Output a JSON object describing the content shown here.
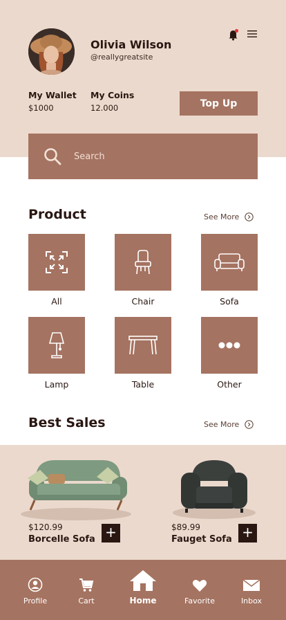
{
  "profile": {
    "name": "Olivia Wilson",
    "handle": "@reallygreatsite"
  },
  "wallet": {
    "wallet_label": "My Wallet",
    "wallet_value": "$1000",
    "coins_label": "My Coins",
    "coins_value": "12.000",
    "topup_label": "Top Up"
  },
  "search": {
    "placeholder": "Search"
  },
  "product_section": {
    "title": "Product",
    "see_more": "See More",
    "categories": [
      {
        "label": "All",
        "icon": "expand-icon"
      },
      {
        "label": "Chair",
        "icon": "chair-icon"
      },
      {
        "label": "Sofa",
        "icon": "sofa-icon"
      },
      {
        "label": "Lamp",
        "icon": "lamp-icon"
      },
      {
        "label": "Table",
        "icon": "table-icon"
      },
      {
        "label": "Other",
        "icon": "more-dots-icon"
      }
    ]
  },
  "best_sales": {
    "title": "Best Sales",
    "see_more": "See More",
    "products": [
      {
        "price": "$120.99",
        "name": "Borcelle Sofa"
      },
      {
        "price": "$89.99",
        "name": "Fauget Sofa"
      }
    ]
  },
  "nav": {
    "items": [
      {
        "label": "Profile",
        "icon": "profile-icon"
      },
      {
        "label": "Cart",
        "icon": "cart-icon"
      },
      {
        "label": "Home",
        "icon": "home-icon",
        "active": true
      },
      {
        "label": "Favorite",
        "icon": "heart-icon"
      },
      {
        "label": "Inbox",
        "icon": "mail-icon"
      }
    ]
  },
  "colors": {
    "accent": "#a57361",
    "background_tint": "#ecd9cd",
    "dark": "#2a1712"
  }
}
